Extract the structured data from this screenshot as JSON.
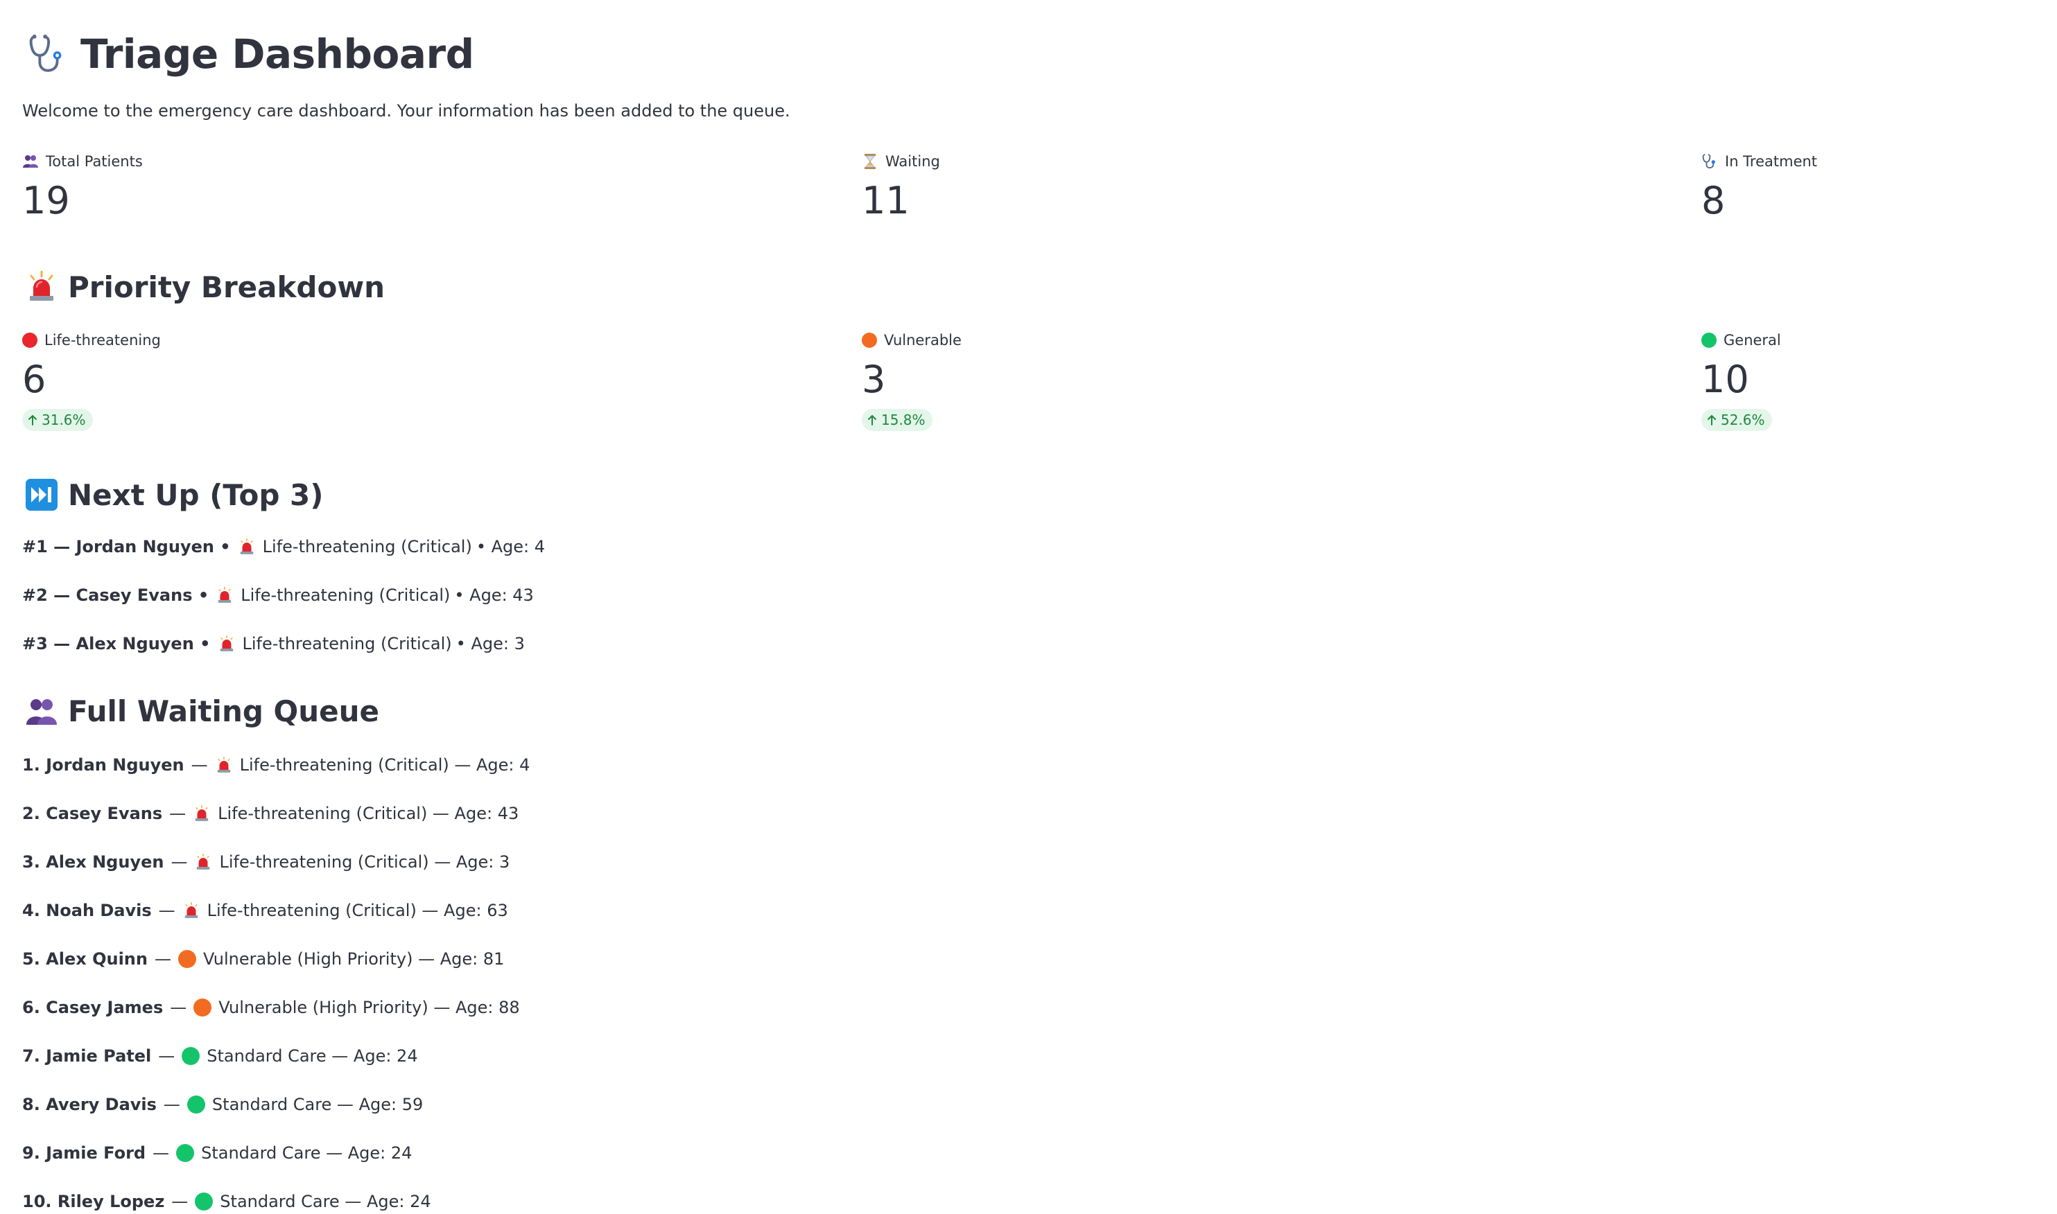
{
  "header": {
    "title": "Triage Dashboard",
    "welcome": "Welcome to the emergency care dashboard. Your information has been added to the queue."
  },
  "summary_metrics": [
    {
      "label": "Total Patients",
      "value": "19",
      "icon": "people-icon"
    },
    {
      "label": "Waiting",
      "value": "11",
      "icon": "hourglass-icon"
    },
    {
      "label": "In Treatment",
      "value": "8",
      "icon": "stethoscope-icon"
    }
  ],
  "priority": {
    "heading": "Priority Breakdown",
    "icon": "siren-icon",
    "metrics": [
      {
        "label": "Life-threatening",
        "value": "6",
        "delta": "31.6%",
        "color": "#e8262b"
      },
      {
        "label": "Vulnerable",
        "value": "3",
        "delta": "15.8%",
        "color": "#f26b21"
      },
      {
        "label": "General",
        "value": "10",
        "delta": "52.6%",
        "color": "#14c46a"
      }
    ]
  },
  "next_up": {
    "heading": "Next Up (Top 3)",
    "icon": "next-track-icon",
    "items": [
      {
        "prefix": "#1 — Jordan Nguyen •",
        "category": "Life-threatening (Critical)",
        "suffix": "• Age: 4"
      },
      {
        "prefix": "#2 — Casey Evans •",
        "category": "Life-threatening (Critical)",
        "suffix": "• Age: 43"
      },
      {
        "prefix": "#3 — Alex Nguyen •",
        "category": "Life-threatening (Critical)",
        "suffix": "• Age: 3"
      }
    ]
  },
  "queue": {
    "heading": "Full Waiting Queue",
    "icon": "people-icon",
    "items": [
      {
        "name": "1. Jordan Nguyen",
        "sep": "—",
        "kind": "siren",
        "category": "Life-threatening (Critical) — Age: 4"
      },
      {
        "name": "2. Casey Evans",
        "sep": "—",
        "kind": "siren",
        "category": "Life-threatening (Critical) — Age: 43"
      },
      {
        "name": "3. Alex Nguyen",
        "sep": "—",
        "kind": "siren",
        "category": "Life-threatening (Critical) — Age: 3"
      },
      {
        "name": "4. Noah Davis",
        "sep": "—",
        "kind": "siren",
        "category": "Life-threatening (Critical) — Age: 63"
      },
      {
        "name": "5. Alex Quinn",
        "sep": "—",
        "kind": "orange",
        "category": "Vulnerable (High Priority) — Age: 81"
      },
      {
        "name": "6. Casey James",
        "sep": "—",
        "kind": "orange",
        "category": "Vulnerable (High Priority) — Age: 88"
      },
      {
        "name": "7. Jamie Patel",
        "sep": "—",
        "kind": "green",
        "category": "Standard Care — Age: 24"
      },
      {
        "name": "8. Avery Davis",
        "sep": "—",
        "kind": "green",
        "category": "Standard Care — Age: 59"
      },
      {
        "name": "9. Jamie Ford",
        "sep": "—",
        "kind": "green",
        "category": "Standard Care — Age: 24"
      },
      {
        "name": "10. Riley Lopez",
        "sep": "—",
        "kind": "green",
        "category": "Standard Care — Age: 24"
      }
    ]
  },
  "colors": {
    "red": "#e8262b",
    "orange": "#f26b21",
    "green": "#14c46a",
    "delta_bg": "#e4f6ea",
    "delta_fg": "#1e8a3e"
  }
}
